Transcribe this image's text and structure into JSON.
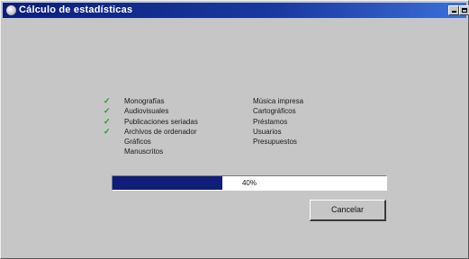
{
  "window": {
    "title": "Cálculo de estadísticas"
  },
  "stats": {
    "left_column": [
      {
        "label": "Monografías",
        "done": true
      },
      {
        "label": "Audiovisuales",
        "done": true
      },
      {
        "label": "Publicaciones seriadas",
        "done": true
      },
      {
        "label": "Archivos de ordenador",
        "done": true
      },
      {
        "label": "Gráficos",
        "done": false
      },
      {
        "label": "Manuscritos",
        "done": false
      }
    ],
    "right_column": [
      {
        "label": "Música impresa"
      },
      {
        "label": "Cartográficos"
      },
      {
        "label": "Préstamos"
      },
      {
        "label": "Usuarios"
      },
      {
        "label": "Presupuestos"
      }
    ]
  },
  "progress": {
    "percent": 40,
    "text": "40%"
  },
  "buttons": {
    "cancel": "Cancelar"
  },
  "colors": {
    "progress_fill": "#0f1e78",
    "check": "#1f9a1f"
  },
  "icons": {
    "app": "globe-icon",
    "check": "check-icon",
    "minimize": "minimize-icon",
    "maximize": "maximize-icon"
  }
}
